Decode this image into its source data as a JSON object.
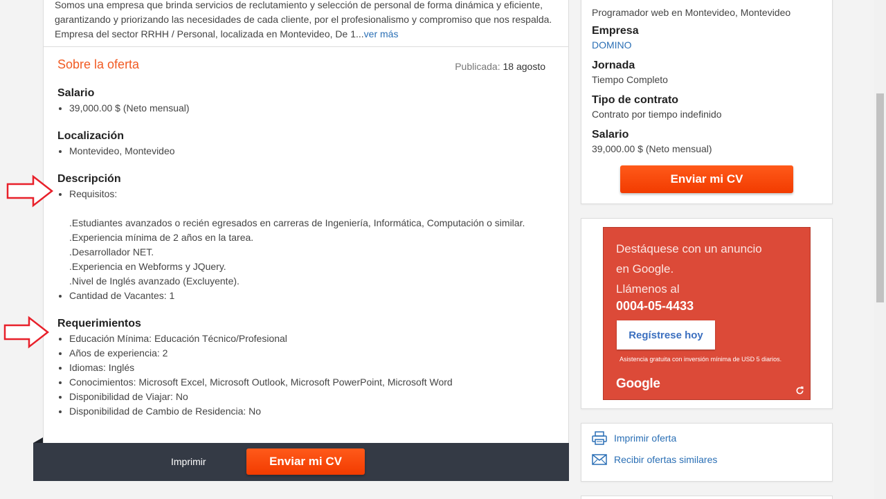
{
  "company": {
    "description": "Somos una empresa que brinda servicios de reclutamiento y selección de personal de forma dinámica y eficiente, garantizando y priorizando las necesidades de cada cliente, por el profesionalismo y compromiso que nos respalda. Empresa del sector RRHH / Personal, localizada en Montevideo, De 1...",
    "more_link": "ver más"
  },
  "offer": {
    "section_title": "Sobre la oferta",
    "published_label": "Publicada:",
    "published_date": "18 agosto",
    "salary": {
      "title": "Salario",
      "value": "39,000.00 $ (Neto mensual)"
    },
    "location": {
      "title": "Localización",
      "value": "Montevideo, Montevideo"
    },
    "description": {
      "title": "Descripción",
      "first_item": "Requisitos:",
      "lines": [
        ".Estudiantes avanzados o recién egresados en carreras de Ingeniería, Informática, Computación o similar.",
        ".Experiencia mínima de 2 años en la tarea.",
        ".Desarrollador NET.",
        ".Experiencia en Webforms y JQuery.",
        ".Nivel de Inglés avanzado (Excluyente)."
      ],
      "vacancies": "Cantidad de Vacantes: 1"
    },
    "requirements": {
      "title": "Requerimientos",
      "items": [
        "Educación Mínima: Educación Técnico/Profesional",
        "Años de experiencia: 2",
        "Idiomas: Inglés",
        "Conocimientos: Microsoft Excel, Microsoft Outlook, Microsoft PowerPoint, Microsoft Word",
        "Disponibilidad de Viajar: No",
        "Disponibilidad de Cambio de Residencia: No"
      ]
    }
  },
  "action_bar": {
    "print_label": "Imprimir",
    "send_cv_label": "Enviar mi CV"
  },
  "summary": {
    "job_title": "Programador web en Montevideo, Montevideo",
    "company_label": "Empresa",
    "company_value": "DOMINO",
    "schedule_label": "Jornada",
    "schedule_value": "Tiempo Completo",
    "contract_label": "Tipo de contrato",
    "contract_value": "Contrato por tiempo indefinido",
    "salary_label": "Salario",
    "salary_value": "39,000.00 $ (Neto mensual)",
    "send_cv_label": "Enviar mi CV"
  },
  "ad": {
    "line1": "Destáquese con un anuncio",
    "line2": "en Google.",
    "line3": "Llámenos al",
    "phone": "0004-05-4433",
    "button": "Regístrese hoy",
    "fine_print": "Asistencia gratuita con inversión mínima de USD 5 diarios.",
    "logo": "Google",
    "background": "#dc4a38"
  },
  "links": {
    "print_offer": "Imprimir oferta",
    "similar_offers": "Recibir ofertas similares"
  },
  "colors": {
    "accent_orange": "#f15a22",
    "link_blue": "#2a6fb5",
    "bar_dark": "#343a45",
    "annotation_red": "#e8202a"
  }
}
